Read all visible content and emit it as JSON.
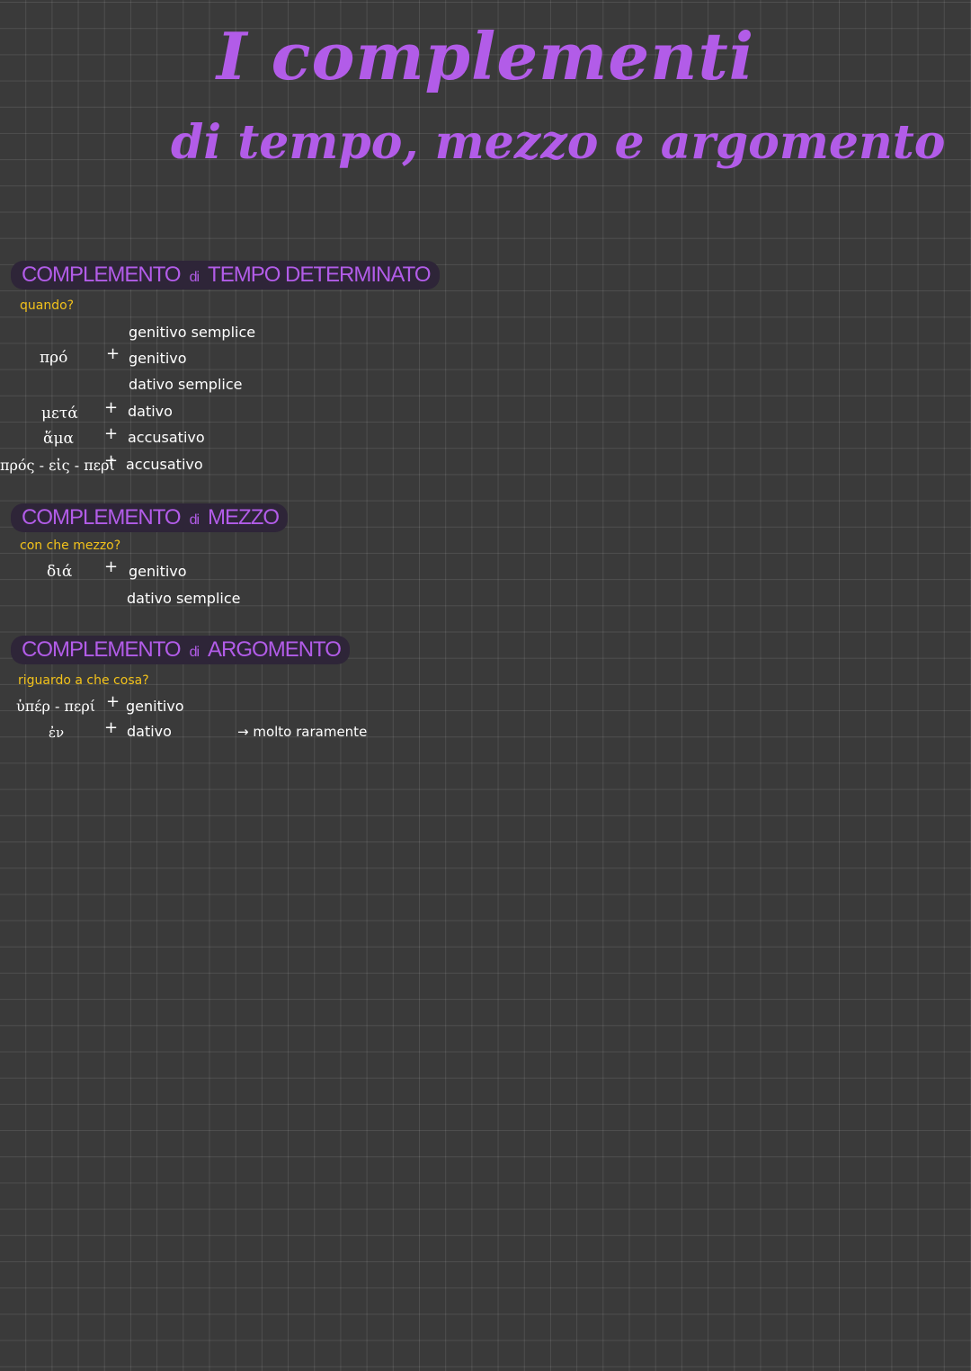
{
  "title": "I complementi",
  "subtitle": "di tempo, mezzo e argomento",
  "sections": {
    "tempo": {
      "heading": {
        "part1": "COMPLEMENTO",
        "part2": "di",
        "part3": "TEMPO DETERMINATO"
      },
      "question": "quando?",
      "rows": [
        {
          "prep": "πρό",
          "cases": [
            "genitivo semplice",
            "genitivo",
            "dativo semplice"
          ]
        },
        {
          "prep": "μετά",
          "cases": [
            "dativo"
          ]
        },
        {
          "prep": "ἅμα",
          "cases": [
            "accusativo"
          ]
        },
        {
          "prep": "πρός - εἰς - περί",
          "cases": [
            "accusativo"
          ]
        }
      ]
    },
    "mezzo": {
      "heading": {
        "part1": "COMPLEMENTO",
        "part2": "di",
        "part3": "MEZZO"
      },
      "question": "con che mezzo?",
      "rows": [
        {
          "prep": "διά",
          "cases": [
            "genitivo",
            "dativo semplice"
          ]
        }
      ]
    },
    "argomento": {
      "heading": {
        "part1": "COMPLEMENTO",
        "part2": "di",
        "part3": "ARGOMENTO"
      },
      "question": "riguardo a che cosa?",
      "rows": [
        {
          "prep": "ὑπέρ - περί",
          "cases": [
            "genitivo"
          ]
        },
        {
          "prep": "ἐν",
          "cases": [
            "dativo"
          ],
          "note": "→ molto raramente"
        }
      ]
    }
  },
  "plus_sign": "+",
  "colors": {
    "accent": "#b25ce8",
    "question": "#f2c21b",
    "text": "#ffffff",
    "background": "#3a3a3a"
  }
}
